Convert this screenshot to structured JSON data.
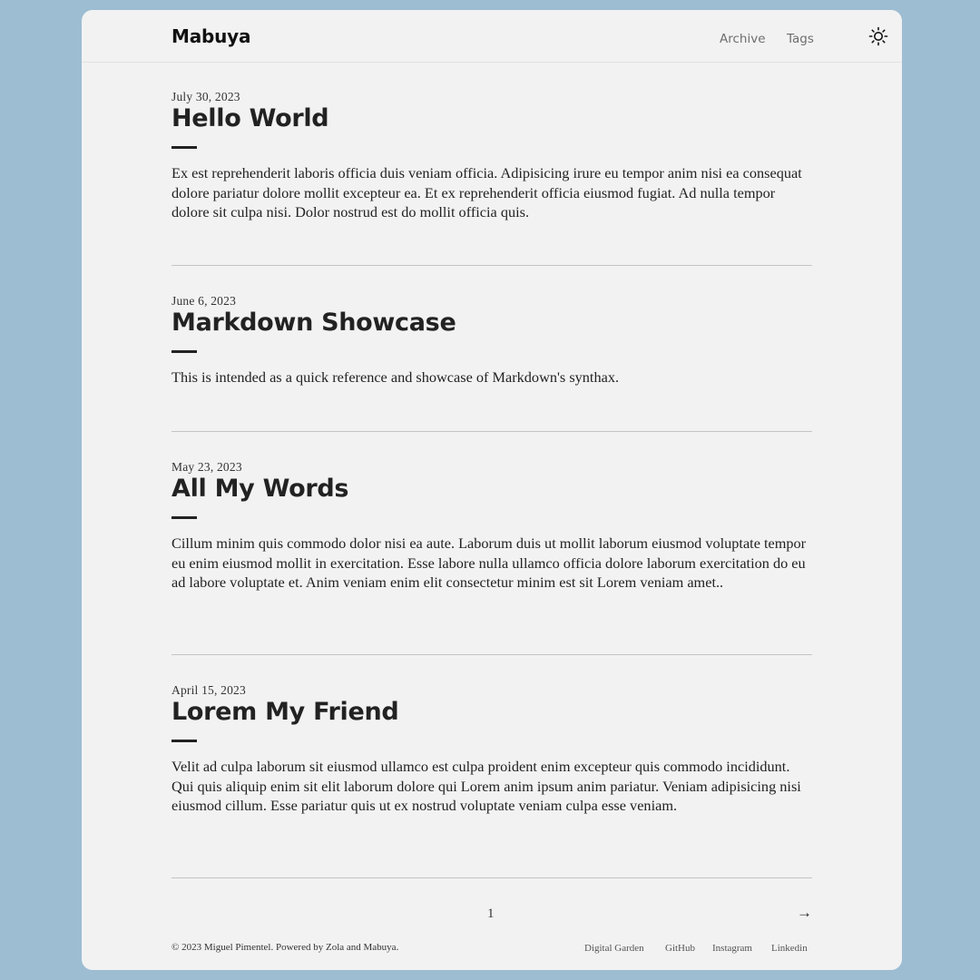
{
  "header": {
    "site_title": "Mabuya",
    "nav": {
      "archive": "Archive",
      "tags": "Tags"
    },
    "theme_toggle_icon": "sun-icon"
  },
  "posts": [
    {
      "date": "July 30, 2023",
      "title": "Hello World",
      "summary": "Ex est reprehenderit laboris officia duis veniam officia. Adipisicing irure eu tempor anim nisi ea consequat dolore pariatur dolore mollit excepteur ea. Et ex reprehenderit officia eiusmod fugiat. Ad nulla tempor dolore sit culpa nisi. Dolor nostrud est do mollit officia quis."
    },
    {
      "date": "June 6, 2023",
      "title": "Markdown Showcase",
      "summary": "This is intended as a quick reference and showcase of Markdown's synthax."
    },
    {
      "date": "May 23, 2023",
      "title": "All My Words",
      "summary": "Cillum minim quis commodo dolor nisi ea aute. Laborum duis ut mollit laborum eiusmod voluptate tempor eu enim eiusmod mollit in exercitation. Esse labore nulla ullamco officia dolore laborum exercitation do eu ad labore voluptate et. Anim veniam enim elit consectetur minim est sit Lorem veniam amet.."
    },
    {
      "date": "April 15, 2023",
      "title": "Lorem My Friend",
      "summary": "Velit ad culpa laborum sit eiusmod ullamco est culpa proident enim excepteur quis commodo incididunt. Qui quis aliquip enim sit elit laborum dolore qui Lorem anim ipsum anim pariatur. Veniam adipisicing nisi eiusmod cillum. Esse pariatur quis ut ex nostrud voluptate veniam culpa esse veniam."
    }
  ],
  "pagination": {
    "current_page": "1",
    "next": "→"
  },
  "footer": {
    "copyright": "© 2023 Miguel Pimentel. Powered by Zola and Mabuya.",
    "links": [
      "Digital Garden",
      "GitHub",
      "Instagram",
      "Linkedin"
    ]
  }
}
